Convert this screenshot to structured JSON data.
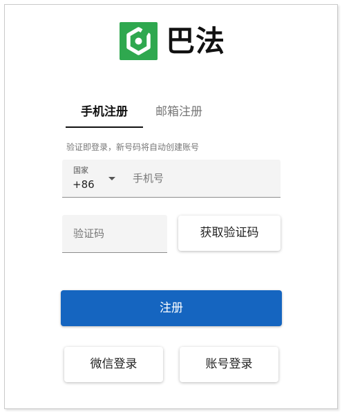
{
  "brand": {
    "name": "巴法",
    "logo_icon": "bafa-logo-icon",
    "logo_color": "#2fa84f"
  },
  "tabs": [
    {
      "label": "手机注册",
      "active": true
    },
    {
      "label": "邮箱注册",
      "active": false
    }
  ],
  "hint": "验证即登录，新号码将自动创建账号",
  "phone": {
    "country_label": "国家",
    "country_code": "+86",
    "placeholder": "手机号",
    "value": ""
  },
  "code": {
    "placeholder": "验证码",
    "value": "",
    "get_code_label": "获取验证码"
  },
  "submit_label": "注册",
  "submit_color": "#1565c0",
  "alt_logins": {
    "wechat_label": "微信登录",
    "account_label": "账号登录"
  }
}
